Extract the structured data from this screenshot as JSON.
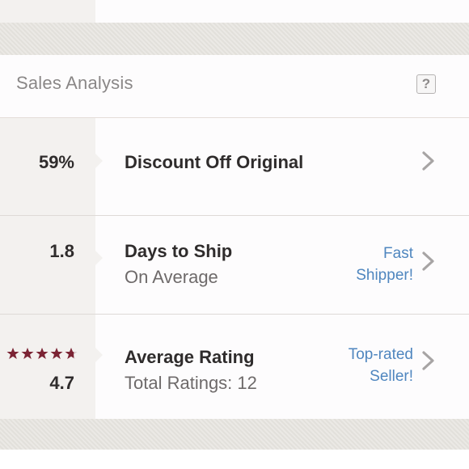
{
  "header": {
    "title": "Sales Analysis",
    "help_label": "?"
  },
  "rows": [
    {
      "value": "59%",
      "title": "Discount Off Original",
      "subtitle": "",
      "tag_line1": "",
      "tag_line2": ""
    },
    {
      "value": "1.8",
      "title": "Days to Ship",
      "subtitle": "On Average",
      "tag_line1": "Fast",
      "tag_line2": "Shipper!"
    },
    {
      "value": "4.7",
      "title": "Average Rating",
      "subtitle": "Total Ratings: 12",
      "tag_line1": "Top-rated",
      "tag_line2": "Seller!"
    }
  ],
  "rating": {
    "stars": 4.7,
    "max": 5
  },
  "icons": {
    "help": "question-mark-icon",
    "chevron": "chevron-right-icon",
    "star": "star-icon"
  },
  "colors": {
    "accent_link": "#4f86bf",
    "star": "#7b2434",
    "metric_bg": "#f3f1ef",
    "band": "#e7e4df"
  }
}
